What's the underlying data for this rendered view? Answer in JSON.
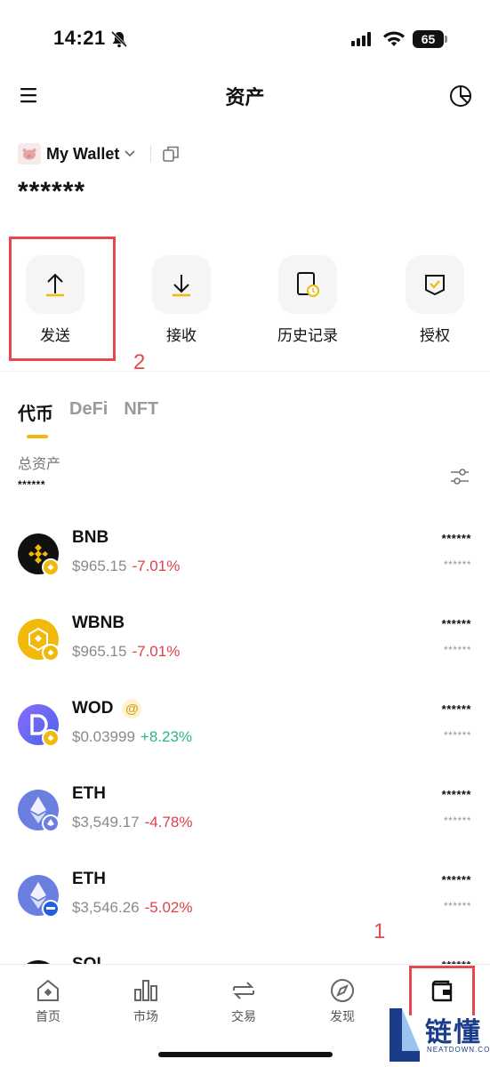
{
  "status_bar": {
    "time": "14:21",
    "battery": "65"
  },
  "header": {
    "title": "资产",
    "menu_icon": "menu-icon",
    "right_icon": "pie-chart-icon"
  },
  "wallet": {
    "name": "My Wallet",
    "balance": "******"
  },
  "actions": [
    {
      "label": "发送",
      "icon": "arrow-up-icon"
    },
    {
      "label": "接收",
      "icon": "arrow-down-icon"
    },
    {
      "label": "历史记录",
      "icon": "history-icon"
    },
    {
      "label": "授权",
      "icon": "shield-check-icon"
    }
  ],
  "annotations": {
    "step2": "2",
    "step1": "1",
    "highlight_color": "#e5484d"
  },
  "tabs": [
    {
      "label": "代币",
      "active": true
    },
    {
      "label": "DeFi",
      "active": false
    },
    {
      "label": "NFT",
      "active": false
    }
  ],
  "total": {
    "label": "总资产",
    "value": "******"
  },
  "tokens": [
    {
      "symbol": "BNB",
      "price": "$965.15",
      "change": "-7.01%",
      "direction": "neg",
      "amount": "******",
      "value": "******",
      "coin_color": "#111111",
      "badge_color": "#f0b90b"
    },
    {
      "symbol": "WBNB",
      "price": "$965.15",
      "change": "-7.01%",
      "direction": "neg",
      "amount": "******",
      "value": "******",
      "coin_color": "#f0b90b",
      "badge_color": "#f0b90b"
    },
    {
      "symbol": "WOD",
      "price": "$0.03999",
      "change": "+8.23%",
      "direction": "pos",
      "amount": "******",
      "value": "******",
      "coin_color": "#6d5dfc",
      "badge_color": "#f0b90b",
      "badge": "@"
    },
    {
      "symbol": "ETH",
      "price": "$3,549.17",
      "change": "-4.78%",
      "direction": "neg",
      "amount": "******",
      "value": "******",
      "coin_color": "#6b7fe0",
      "badge_color": "#6b7fe0"
    },
    {
      "symbol": "ETH",
      "price": "$3,546.26",
      "change": "-5.02%",
      "direction": "neg",
      "amount": "******",
      "value": "******",
      "coin_color": "#6b7fe0",
      "badge_color": "#1f5fe0"
    },
    {
      "symbol": "SOL",
      "price": "",
      "change": "",
      "direction": "neg",
      "amount": "******",
      "value": "",
      "coin_color": "#111111",
      "badge_color": "#111111"
    }
  ],
  "bottom_nav": [
    {
      "label": "首页",
      "icon": "home-icon"
    },
    {
      "label": "市场",
      "icon": "market-icon"
    },
    {
      "label": "交易",
      "icon": "swap-icon"
    },
    {
      "label": "发现",
      "icon": "compass-icon"
    },
    {
      "label": "",
      "icon": "wallet-icon"
    }
  ],
  "watermark": {
    "text": "链懂",
    "sub": "NEATDOWN.COM"
  }
}
